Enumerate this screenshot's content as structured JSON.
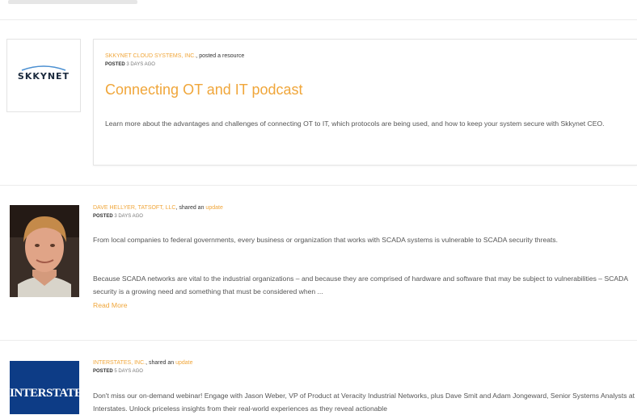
{
  "feed": {
    "items": [
      {
        "org": "SKKYNET CLOUD SYSTEMS, INC.",
        "action_text": "posted a resource",
        "posted_label": "POSTED",
        "posted_time": "3 DAYS AGO",
        "title": "Connecting OT and IT podcast",
        "description": "Learn more about the advantages and challenges of connecting OT to IT, which protocols are being used, and how to keep your system secure with Skkynet CEO.",
        "logo_text": "SKKYNET"
      },
      {
        "author": "DAVE HELLYER, TATSOFT, LLC",
        "action_text": "shared an",
        "action_link": "update",
        "posted_label": "POSTED",
        "posted_time": "3 DAYS AGO",
        "paragraph1": "From local companies to federal governments, every business or organization that works with SCADA systems is vulnerable to SCADA security threats.",
        "paragraph2": "Because SCADA networks are vital to the industrial organizations – and because they are comprised of hardware and software that may be subject to vulnerabilities – SCADA security is a growing need and something that must be considered when ...",
        "read_more": "Read More"
      },
      {
        "org": "INTERSTATES, INC.",
        "action_text": "shared an",
        "action_link": "update",
        "posted_label": "POSTED",
        "posted_time": "5 DAYS AGO",
        "body": "Don't miss our on-demand webinar! Engage with Jason Weber, VP of Product at Veracity Industrial Networks, plus Dave Smit and Adam Jongeward, Senior Systems Analysts at Interstates. Unlock priceless insights from their real-world experiences as they reveal actionable",
        "logo_text": "INTERSTATES"
      }
    ]
  }
}
